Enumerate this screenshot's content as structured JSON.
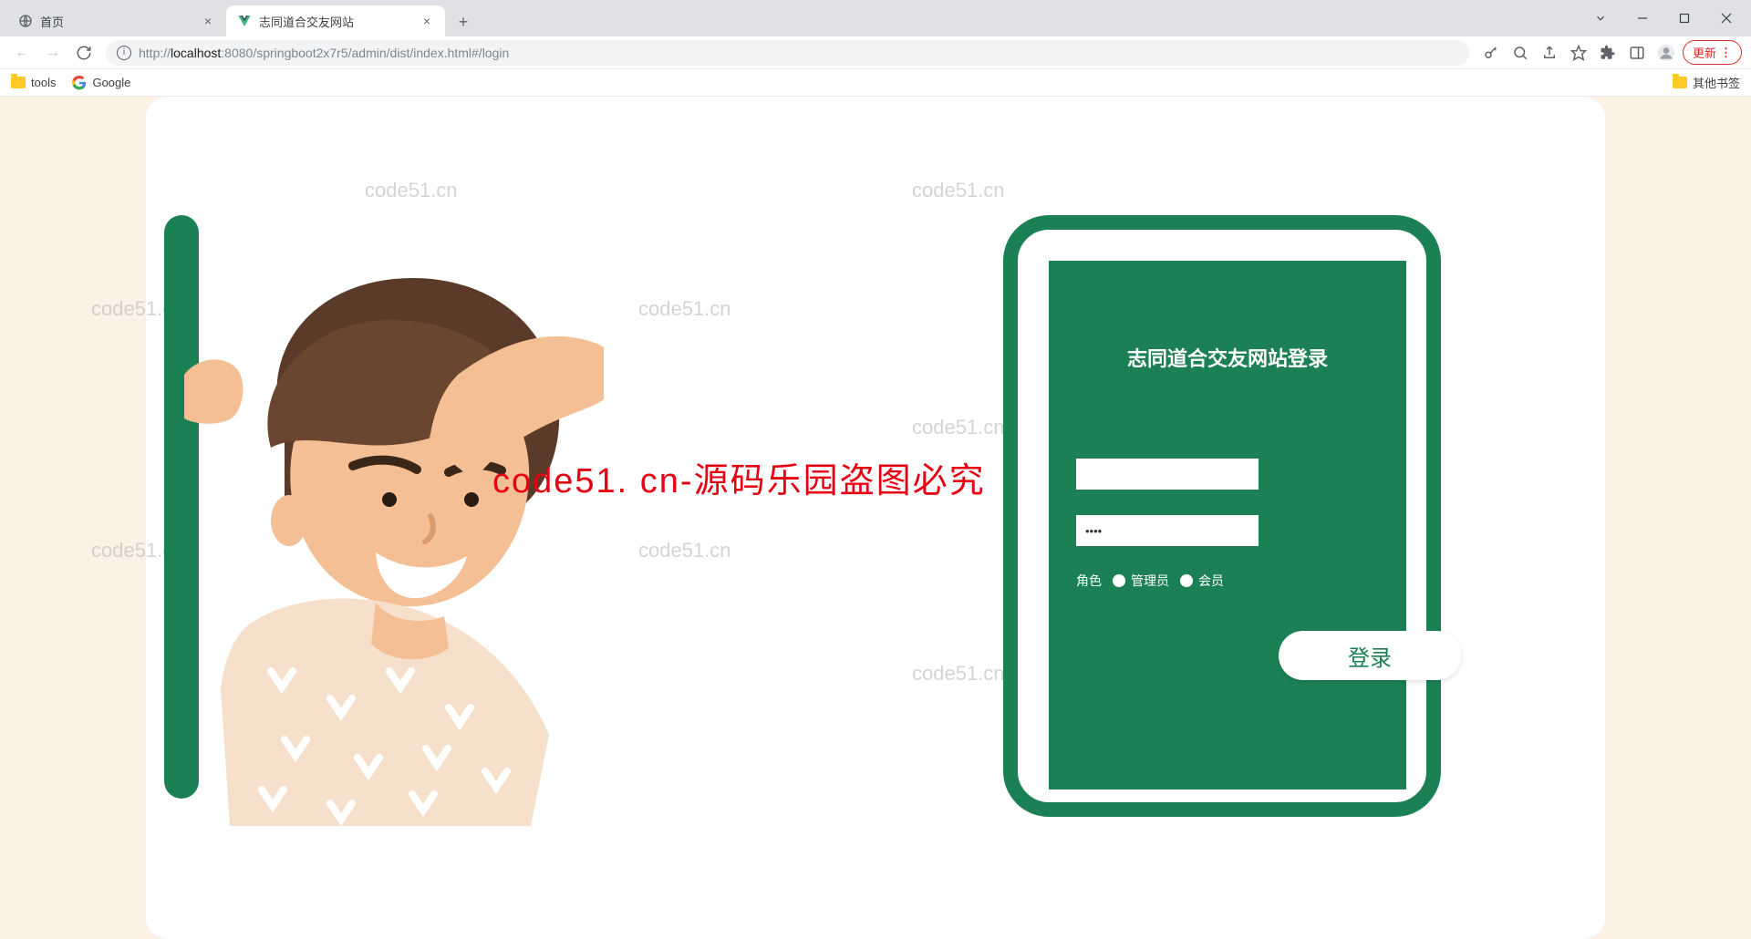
{
  "browser": {
    "tabs": [
      {
        "title": "首页",
        "active": false
      },
      {
        "title": "志同道合交友网站",
        "active": true
      }
    ],
    "url": "http://localhost:8080/springboot2x7r5/admin/dist/index.html#/login",
    "url_scheme": "http://",
    "url_host": "localhost",
    "url_port": ":8080",
    "url_path": "/springboot2x7r5/admin/dist/index.html#/login",
    "update_label": "更新",
    "bookmarks": [
      {
        "label": "tools"
      },
      {
        "label": "Google"
      }
    ],
    "other_bookmarks": "其他书签"
  },
  "login": {
    "title": "志同道合交友网站登录",
    "username_value": "",
    "password_value": "****",
    "role_label": "角色",
    "roles": [
      "管理员",
      "会员"
    ],
    "submit_label": "登录"
  },
  "watermarks": {
    "w": "code51.cn",
    "red": "code51. cn-源码乐园盗图必究"
  }
}
